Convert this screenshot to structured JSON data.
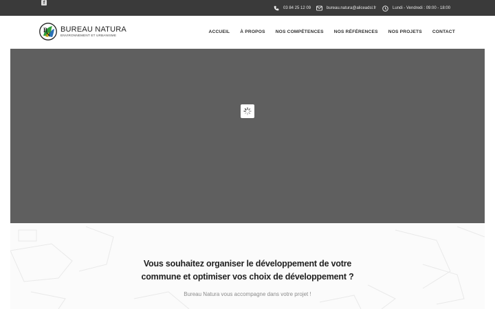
{
  "topbar": {
    "social": [
      {
        "icon": "facebook-icon",
        "glyph": "f"
      }
    ],
    "phone": "03 84 25 12 09",
    "email": "bureau.natura@aliceadsl.fr",
    "hours": "Lundi - Vendredi : 09:00 - 18:00"
  },
  "brand": {
    "name": "BUREAU NATURA",
    "subtitle": "ENVIRONNEMENT ET URBANISME"
  },
  "nav": {
    "items": [
      "ACCUEIL",
      "À PROPOS",
      "NOS COMPÉTENCES",
      "NOS RÉFÉRENCES",
      "NOS PROJETS",
      "CONTACT"
    ]
  },
  "intro": {
    "title_line1": "Vous souhaitez organiser le développement de votre",
    "title_line2": "commune et optimiser vos choix de développement ?",
    "text": "Bureau Natura vous accompagne dans votre projet !"
  },
  "colors": {
    "topbar_bg": "#3a3a3a",
    "slider_bg": "#5f5f5f",
    "logo_green": "#2e9e3a",
    "logo_blue": "#2a6fb5",
    "logo_yellow": "#f2c418"
  }
}
